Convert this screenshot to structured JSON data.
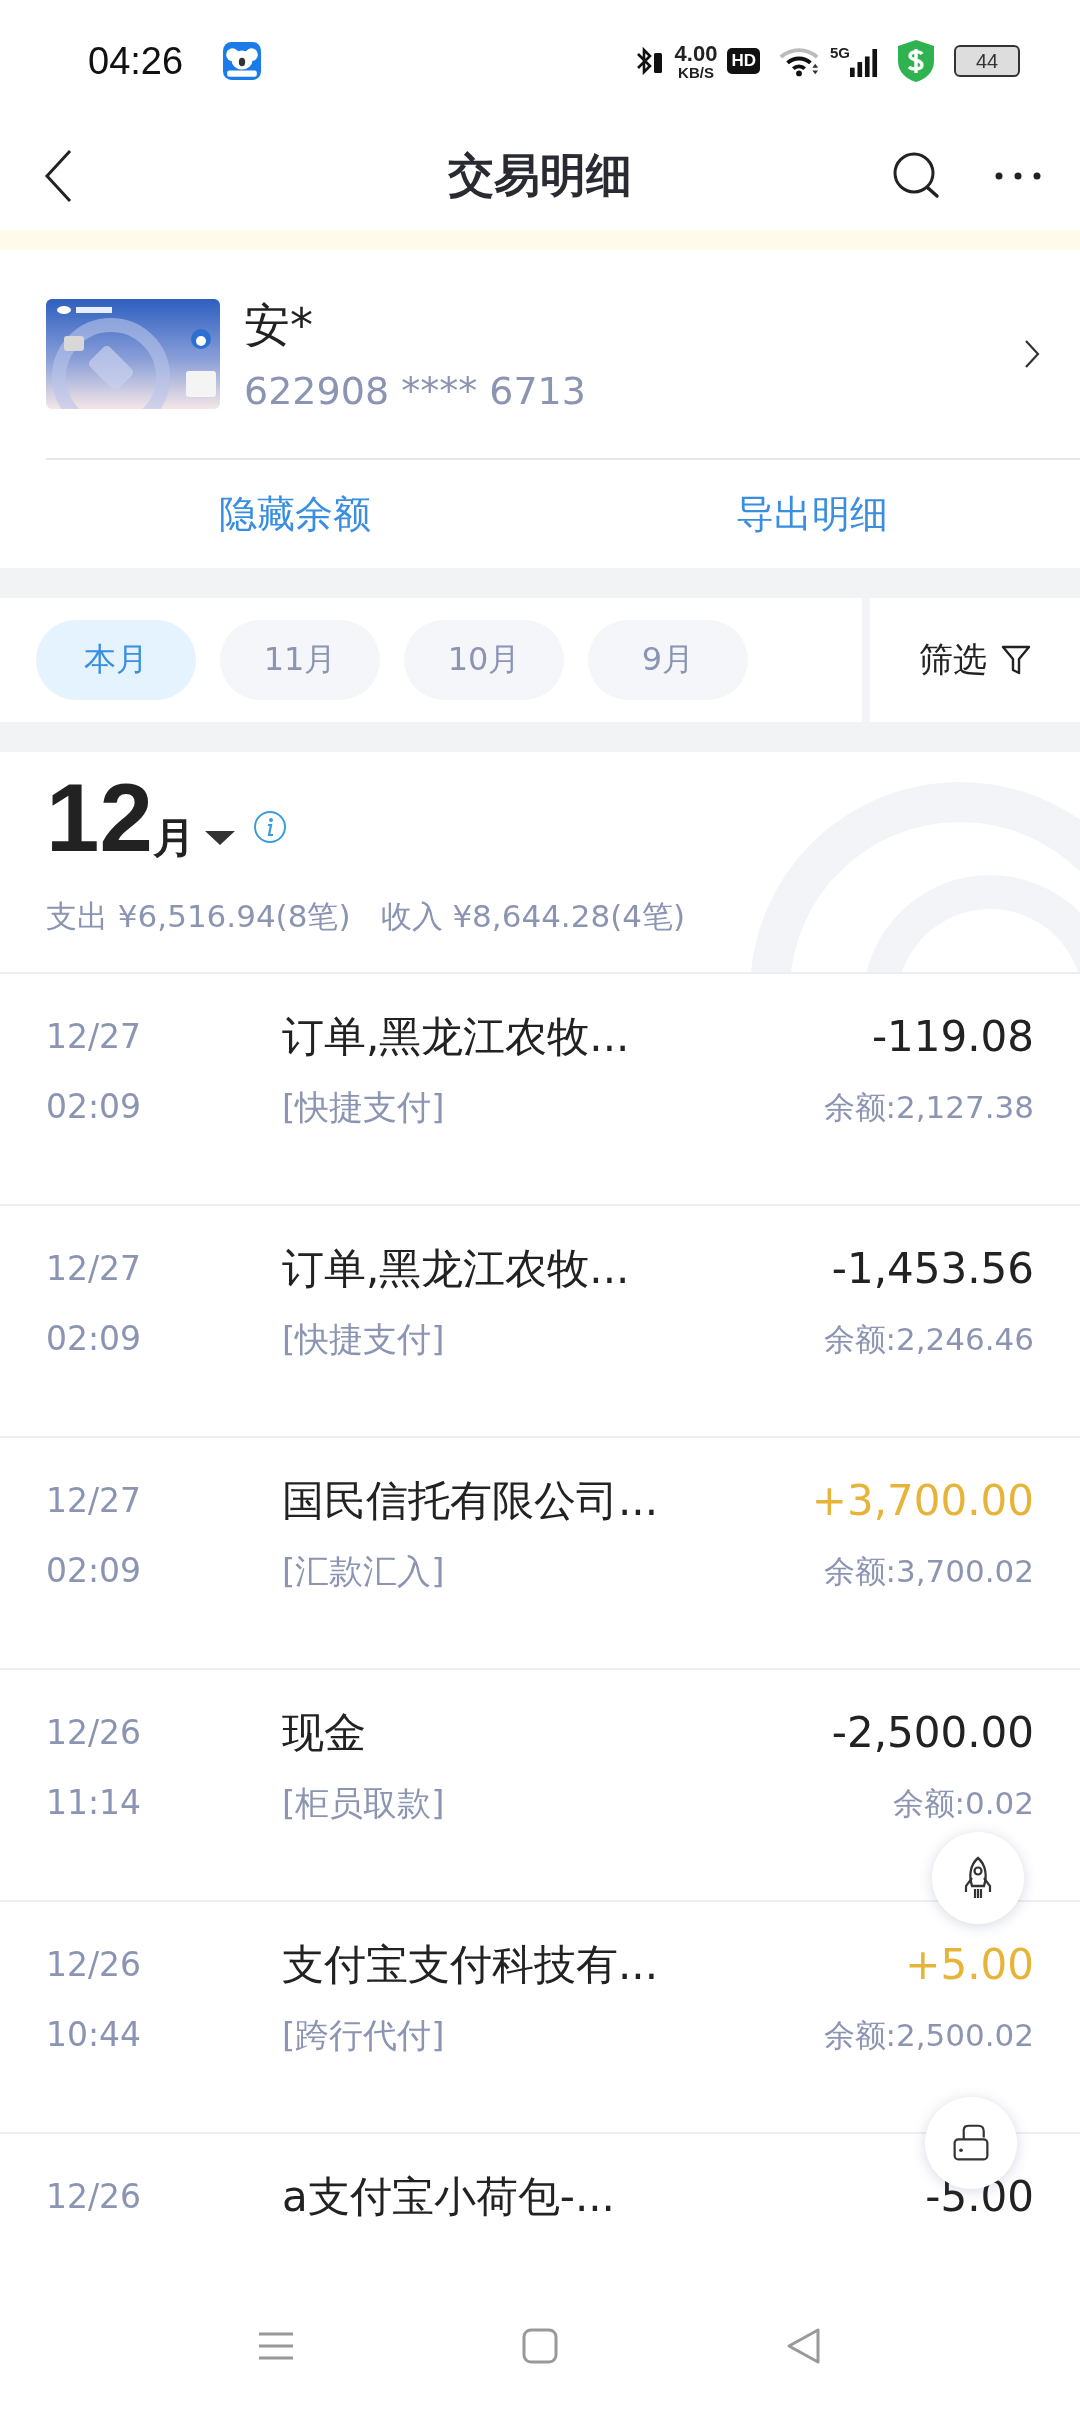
{
  "status_bar": {
    "time": "04:26",
    "speed_value": "4.00",
    "speed_unit": "KB/S",
    "hd": "HD",
    "network": "5G",
    "battery": "44"
  },
  "nav": {
    "title": "交易明细"
  },
  "account": {
    "name": "安*",
    "number": "622908 **** 6713",
    "actions": [
      "隐藏余额",
      "导出明细"
    ]
  },
  "months": [
    {
      "label": "本月",
      "selected": true
    },
    {
      "label": "11月",
      "selected": false
    },
    {
      "label": "10月",
      "selected": false
    },
    {
      "label": "9月",
      "selected": false
    }
  ],
  "filter": {
    "label": "筛选"
  },
  "summary": {
    "month_number": "12",
    "month_unit": "月",
    "expense": "支出 ¥6,516.94(8笔)",
    "income": "收入 ¥8,644.28(4笔)"
  },
  "transactions": [
    {
      "date": "12/27",
      "time": "02:09",
      "title": "订单,黑龙江农牧...",
      "channel": "[快捷支付]",
      "amount": "-119.08",
      "balance": "余额:2,127.38",
      "kind": "expense"
    },
    {
      "date": "12/27",
      "time": "02:09",
      "title": "订单,黑龙江农牧...",
      "channel": "[快捷支付]",
      "amount": "-1,453.56",
      "balance": "余额:2,246.46",
      "kind": "expense"
    },
    {
      "date": "12/27",
      "time": "02:09",
      "title": "国民信托有限公司...",
      "channel": "[汇款汇入]",
      "amount": "+3,700.00",
      "balance": "余额:3,700.02",
      "kind": "income"
    },
    {
      "date": "12/26",
      "time": "11:14",
      "title": "现金",
      "channel": "[柜员取款]",
      "amount": "-2,500.00",
      "balance": "余额:0.02",
      "kind": "expense"
    },
    {
      "date": "12/26",
      "time": "10:44",
      "title": "支付宝支付科技有...",
      "channel": "[跨行代付]",
      "amount": "+5.00",
      "balance": "余额:2,500.02",
      "kind": "income"
    },
    {
      "date": "12/26",
      "title": "a支付宝小荷包-...",
      "amount": "-5.00",
      "kind": "expense"
    }
  ]
}
